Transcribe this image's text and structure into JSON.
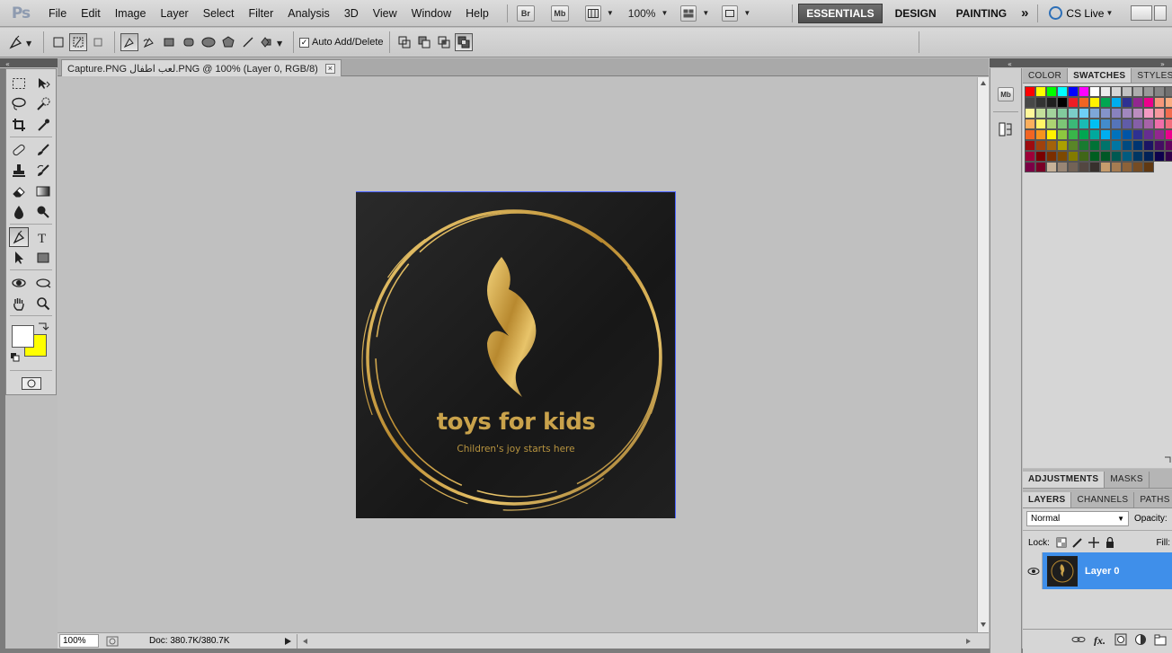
{
  "app": {
    "logo": "Ps"
  },
  "menu": [
    "File",
    "Edit",
    "Image",
    "Layer",
    "Select",
    "Filter",
    "Analysis",
    "3D",
    "View",
    "Window",
    "Help"
  ],
  "appbar": {
    "bridge_label": "Br",
    "minibridge_label": "Mb",
    "zoom": "100%",
    "workspaces": [
      "ESSENTIALS",
      "DESIGN",
      "PAINTING"
    ],
    "active_workspace": "ESSENTIALS",
    "more": "»",
    "cslive": "CS Live"
  },
  "options": {
    "auto_add_delete_label": "Auto Add/Delete",
    "auto_add_delete_checked": true
  },
  "document": {
    "tab_title": "Capture.PNG لعب اطفال.PNG @ 100% (Layer 0, RGB/8)",
    "close_glyph": "×",
    "zoom": "100%",
    "doc_info": "Doc: 380.7K/380.7K"
  },
  "artwork": {
    "title": "toys for kids",
    "tagline": "Children's joy starts here",
    "accent_color": "#c9a24b"
  },
  "panels": {
    "top_tabs": [
      "COLOR",
      "SWATCHES",
      "STYLES"
    ],
    "top_active": "SWATCHES",
    "mid_tabs": [
      "ADJUSTMENTS",
      "MASKS"
    ],
    "mid_active": "ADJUSTMENTS",
    "layer_tabs": [
      "LAYERS",
      "CHANNELS",
      "PATHS"
    ],
    "layer_active": "LAYERS",
    "blend_mode": "Normal",
    "opacity_label": "Opacity:",
    "lock_label": "Lock:",
    "fill_label": "Fill:",
    "layer_name": "Layer 0",
    "strip_minibridge": "Mb"
  },
  "colors": {
    "foreground": "#ffffff",
    "background": "#ffff00",
    "selection_blue": "#3f8fea"
  },
  "swatches": [
    "#ff0000",
    "#ffff00",
    "#00ff00",
    "#00ffff",
    "#0000ff",
    "#ff00ff",
    "#ffffff",
    "#ebebeb",
    "#d6d6d6",
    "#c2c2c2",
    "#adadad",
    "#999999",
    "#858585",
    "#707070",
    "#5c5c5c",
    "#474747",
    "#333333",
    "#1f1f1f",
    "#000000",
    "#ed1c24",
    "#f26522",
    "#fff200",
    "#00a651",
    "#00aeef",
    "#2e3192",
    "#92278f",
    "#ec008c",
    "#f7977a",
    "#f9ad81",
    "#fdc68a",
    "#fff79a",
    "#c4df9b",
    "#a3d39c",
    "#82ca9d",
    "#7bcdc8",
    "#6ecff6",
    "#7ea7d8",
    "#8493ca",
    "#8882be",
    "#a187be",
    "#bc8dbf",
    "#f49ac2",
    "#f6989d",
    "#f26c4f",
    "#f68e56",
    "#fbaf5d",
    "#fff467",
    "#acd372",
    "#7cc576",
    "#3bb878",
    "#1abbb4",
    "#00bff3",
    "#438ccb",
    "#5574b9",
    "#605ca8",
    "#855fa8",
    "#a763a8",
    "#f06ea9",
    "#f26d7d",
    "#ed1c24",
    "#f26522",
    "#f7941d",
    "#fff200",
    "#8dc73f",
    "#39b54a",
    "#00a651",
    "#00a99d",
    "#00aeef",
    "#0072bc",
    "#0054a6",
    "#2e3192",
    "#662d91",
    "#92278f",
    "#ec008c",
    "#ed145b",
    "#9e0b0f",
    "#a0410d",
    "#a3620a",
    "#aba000",
    "#598527",
    "#197b30",
    "#007236",
    "#00746b",
    "#0076a3",
    "#004a80",
    "#003471",
    "#1b1464",
    "#440e62",
    "#630460",
    "#9e005d",
    "#9e0039",
    "#790000",
    "#7b2e00",
    "#7d4900",
    "#827b00",
    "#406618",
    "#005e20",
    "#005826",
    "#005952",
    "#005b7f",
    "#003663",
    "#002157",
    "#0d004c",
    "#32004b",
    "#4b0049",
    "#7b0046",
    "#7a0026",
    "#c7b299",
    "#998675",
    "#736357",
    "#534741",
    "#37302d",
    "#c69c6d",
    "#a67c52",
    "#8c6239",
    "#754c24",
    "#603913"
  ]
}
